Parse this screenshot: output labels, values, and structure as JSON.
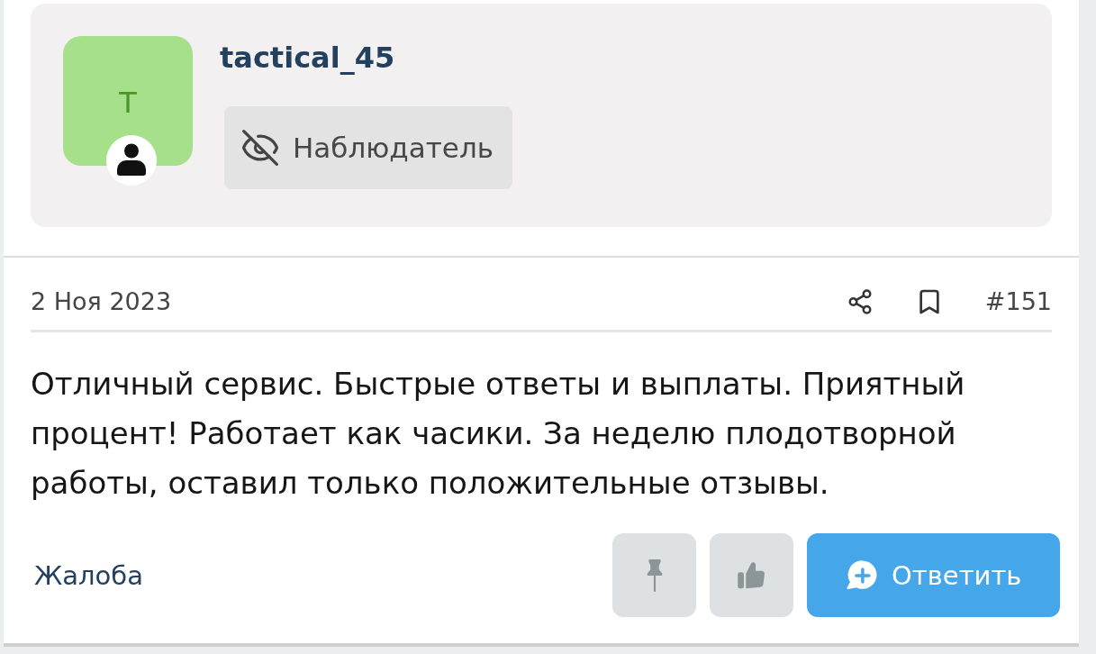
{
  "author": {
    "avatar_letter": "T",
    "username": "tactical_45",
    "role": "Наблюдатель"
  },
  "post": {
    "date": "2 Ноя 2023",
    "number": "#151",
    "body": "Отличный сервис. Быстрые ответы и выплаты. Приятный процент! Работает как часики. За неделю плодотворной работы, оставил только положительные отзывы.",
    "report_label": "Жалоба",
    "actions": [
      {
        "kind": "pin"
      },
      {
        "kind": "like"
      },
      {
        "kind": "reply",
        "label": "Ответить"
      }
    ]
  }
}
